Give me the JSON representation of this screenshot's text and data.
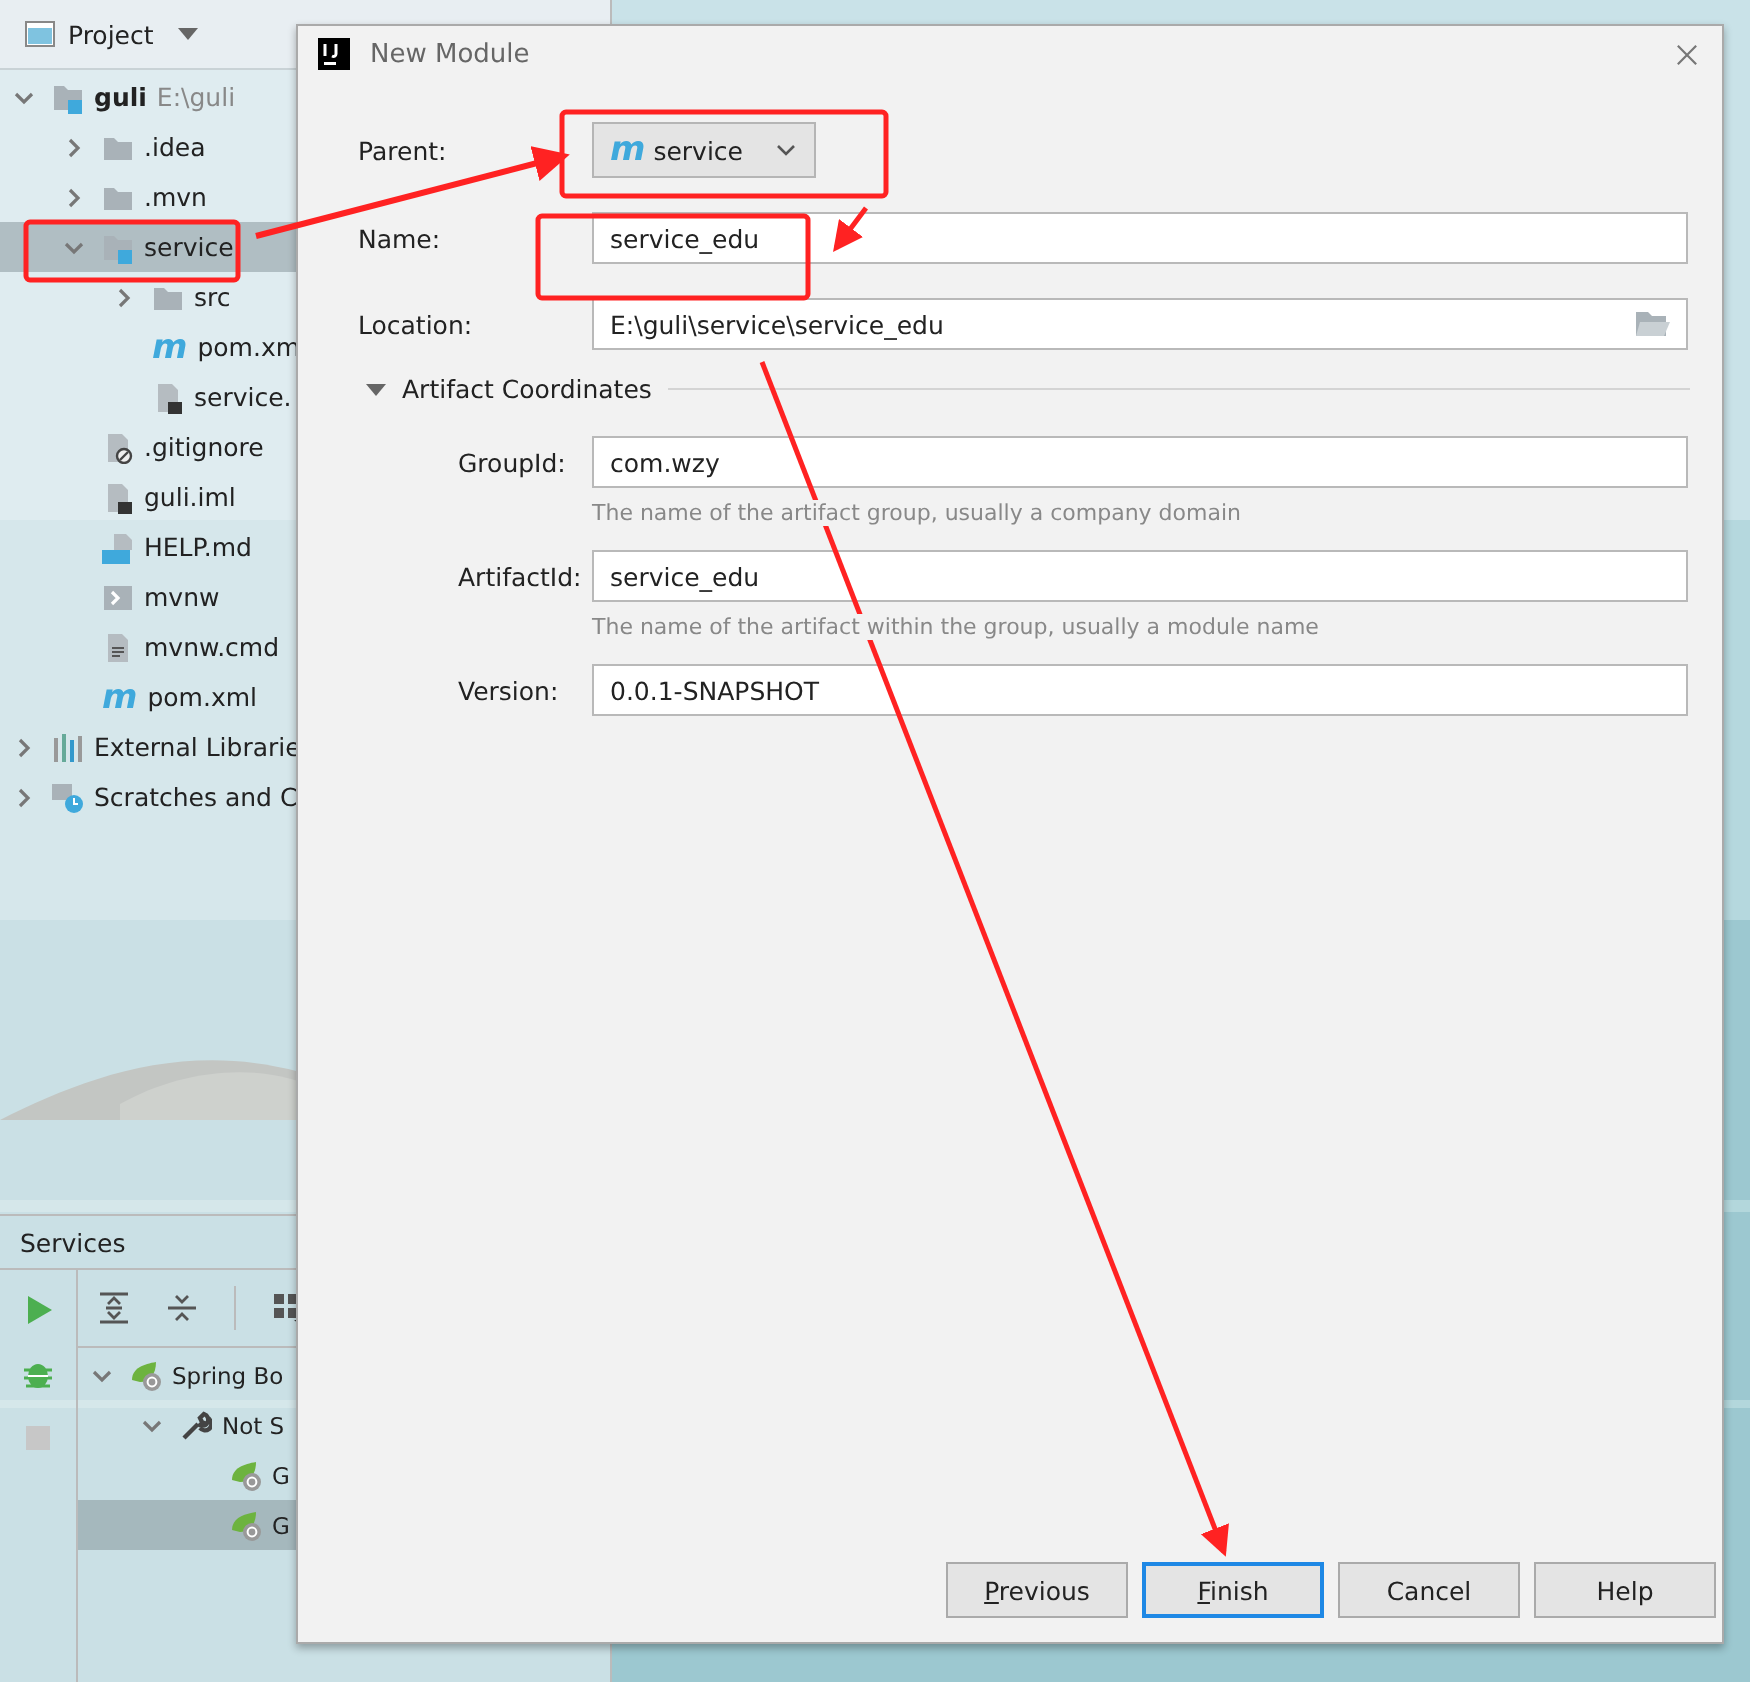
{
  "project_panel": {
    "title": "Project",
    "tree": [
      {
        "label": "guli",
        "hint": "E:\\guli",
        "kind": "module",
        "expanded": true,
        "selected": false,
        "children": [
          {
            "label": ".idea",
            "kind": "folder",
            "expanded": false,
            "selected": false
          },
          {
            "label": ".mvn",
            "kind": "folder",
            "expanded": false,
            "selected": false
          },
          {
            "label": "service",
            "kind": "module",
            "expanded": true,
            "selected": true,
            "children": [
              {
                "label": "src",
                "kind": "folder",
                "expanded": false,
                "selected": false
              },
              {
                "label": "pom.xm",
                "kind": "maven",
                "glyph": "m",
                "selected": false
              },
              {
                "label": "service.",
                "kind": "iml",
                "selected": false
              }
            ]
          },
          {
            "label": ".gitignore",
            "kind": "ignore",
            "selected": false
          },
          {
            "label": "guli.iml",
            "kind": "iml",
            "selected": false
          },
          {
            "label": "HELP.md",
            "kind": "markdown",
            "selected": false
          },
          {
            "label": "mvnw",
            "kind": "shell",
            "selected": false
          },
          {
            "label": "mvnw.cmd",
            "kind": "text",
            "selected": false
          },
          {
            "label": "pom.xml",
            "kind": "maven",
            "glyph": "m",
            "selected": false
          }
        ]
      },
      {
        "label": "External Librarie",
        "kind": "libraries",
        "expanded": false,
        "selected": false
      },
      {
        "label": "Scratches and C",
        "kind": "scratches",
        "expanded": false,
        "selected": false
      }
    ]
  },
  "services_panel": {
    "title": "Services",
    "tree": [
      {
        "label": "Spring Bo",
        "kind": "spring",
        "expanded": true,
        "selected": false,
        "children": [
          {
            "label": "Not S",
            "kind": "wrench",
            "expanded": true,
            "selected": false,
            "children": [
              {
                "label": "G",
                "kind": "spring",
                "selected": false
              },
              {
                "label": "G",
                "kind": "spring",
                "selected": true
              }
            ]
          }
        ]
      }
    ]
  },
  "dialog": {
    "title": "New Module",
    "parent": {
      "label": "Parent:",
      "glyph": "m",
      "value": "service"
    },
    "fields": [
      {
        "label": "Name:",
        "value": "service_edu",
        "kind": "text"
      },
      {
        "label": "Location:",
        "value": "E:\\guli\\service\\service_edu",
        "kind": "path"
      }
    ],
    "section": {
      "label": "Artifact Coordinates",
      "expanded": true
    },
    "artifact_fields": [
      {
        "label": "GroupId:",
        "value": "com.wzy",
        "hint": "The name of the artifact group, usually a company domain"
      },
      {
        "label": "ArtifactId:",
        "value": "service_edu",
        "hint": "The name of the artifact within the group, usually a module name"
      },
      {
        "label": "Version:",
        "value": "0.0.1-SNAPSHOT"
      }
    ],
    "buttons": [
      {
        "label": "Previous",
        "mnemonic": true,
        "default": false
      },
      {
        "label": "Finish",
        "mnemonic": true,
        "default": true
      },
      {
        "label": "Cancel",
        "default": false
      },
      {
        "label": "Help",
        "default": false
      }
    ]
  }
}
